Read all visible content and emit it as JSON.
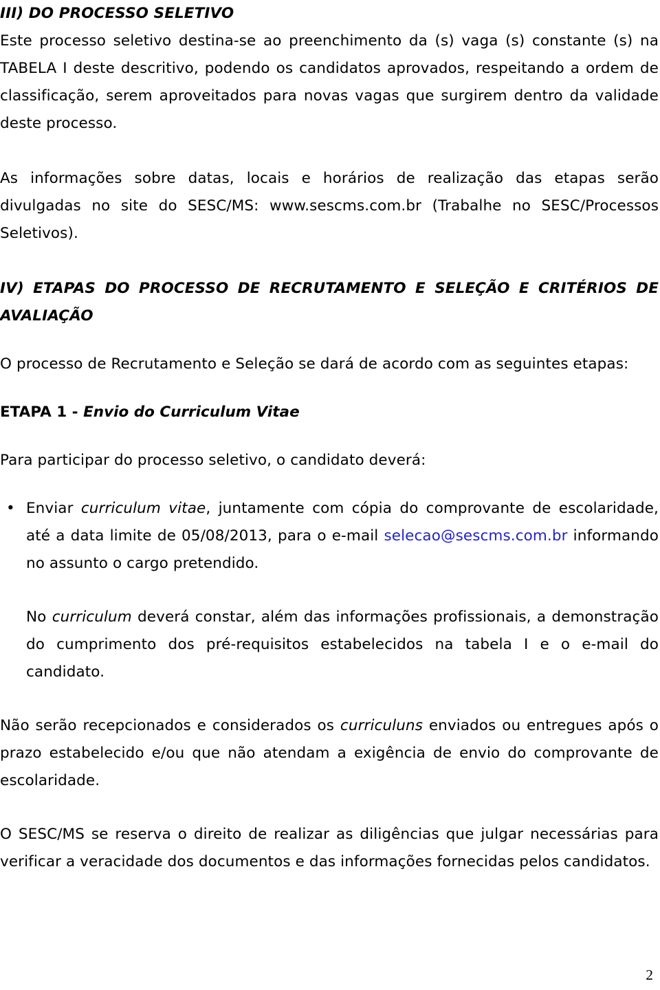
{
  "document": {
    "page_number": "2",
    "link_color": "#2222cc",
    "text_color": "#000000",
    "background_color": "#ffffff"
  },
  "sections": {
    "heading_iii": "III) DO PROCESSO SELETIVO",
    "para_1": "Este processo seletivo destina-se ao preenchimento da (s) vaga (s) constante (s) na TABELA I deste descritivo, podendo os candidatos aprovados, respeitando a ordem de classificação, serem aproveitados para novas vagas que surgirem dentro da validade deste processo.",
    "para_2": "As informações sobre datas, locais e horários de realização das etapas serão divulgadas no site do SESC/MS: www.sescms.com.br (Trabalhe no SESC/Processos Seletivos).",
    "heading_iv": "IV) ETAPAS DO PROCESSO DE RECRUTAMENTO E SELEÇÃO E CRITÉRIOS DE AVALIAÇÃO",
    "para_3": "O processo de Recrutamento e Seleção se dará de acordo com as seguintes etapas:",
    "etapa_1_prefix": "ETAPA 1 - ",
    "etapa_1_title": "Envio do Curriculum Vitae",
    "para_4": "Para participar do processo seletivo, o candidato deverá:",
    "bullet_1": {
      "marker": "•",
      "text_part_1": "Enviar ",
      "italic_1": "curriculum vitae",
      "text_part_2": ", juntamente com cópia do comprovante de escolaridade, até a data limite de 05/08/2013, para o e-mail ",
      "email": "selecao@sescms.com.br",
      "text_part_3": " informando no assunto o cargo pretendido."
    },
    "para_5": {
      "text_part_1": "No ",
      "italic_1": "curriculum",
      "text_part_2": " deverá constar, além das informações profissionais, a demonstração do cumprimento dos pré-requisitos estabelecidos na tabela I e o e-mail do candidato."
    },
    "para_6": {
      "text_part_1": "Não serão recepcionados e considerados os ",
      "italic_1": "curriculuns",
      "text_part_2": " enviados ou entregues após o prazo estabelecido e/ou que não atendam a exigência de envio do comprovante de escolaridade."
    },
    "para_7": "O SESC/MS se reserva o direito de realizar as diligências que julgar necessárias para verificar a veracidade dos documentos e das informações fornecidas pelos candidatos."
  }
}
